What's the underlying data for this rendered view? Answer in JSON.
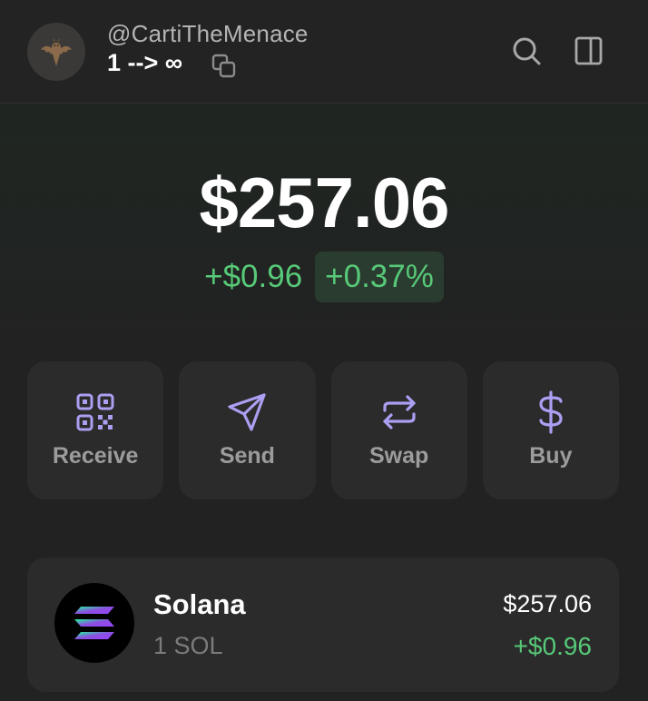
{
  "header": {
    "avatar_icon": "bat-emoji-icon",
    "username": "@CartiTheMenace",
    "account_name": "1 --> ∞",
    "copy_icon": "copy-icon",
    "search_icon": "search-icon",
    "sidebar_icon": "sidebar-panel-icon"
  },
  "balance": {
    "total": "$257.06",
    "change_abs": "+$0.96",
    "change_pct": "+0.37%"
  },
  "actions": [
    {
      "label": "Receive",
      "icon": "qr-code-icon"
    },
    {
      "label": "Send",
      "icon": "send-icon"
    },
    {
      "label": "Swap",
      "icon": "swap-icon"
    },
    {
      "label": "Buy",
      "icon": "dollar-icon"
    }
  ],
  "tokens": [
    {
      "name": "Solana",
      "amount": "1 SOL",
      "value": "$257.06",
      "change": "+$0.96",
      "icon": "solana-logo-icon"
    }
  ],
  "colors": {
    "accent": "#ab9ff2",
    "positive": "#57c978",
    "background": "#222222",
    "card": "#2b2b2b"
  }
}
